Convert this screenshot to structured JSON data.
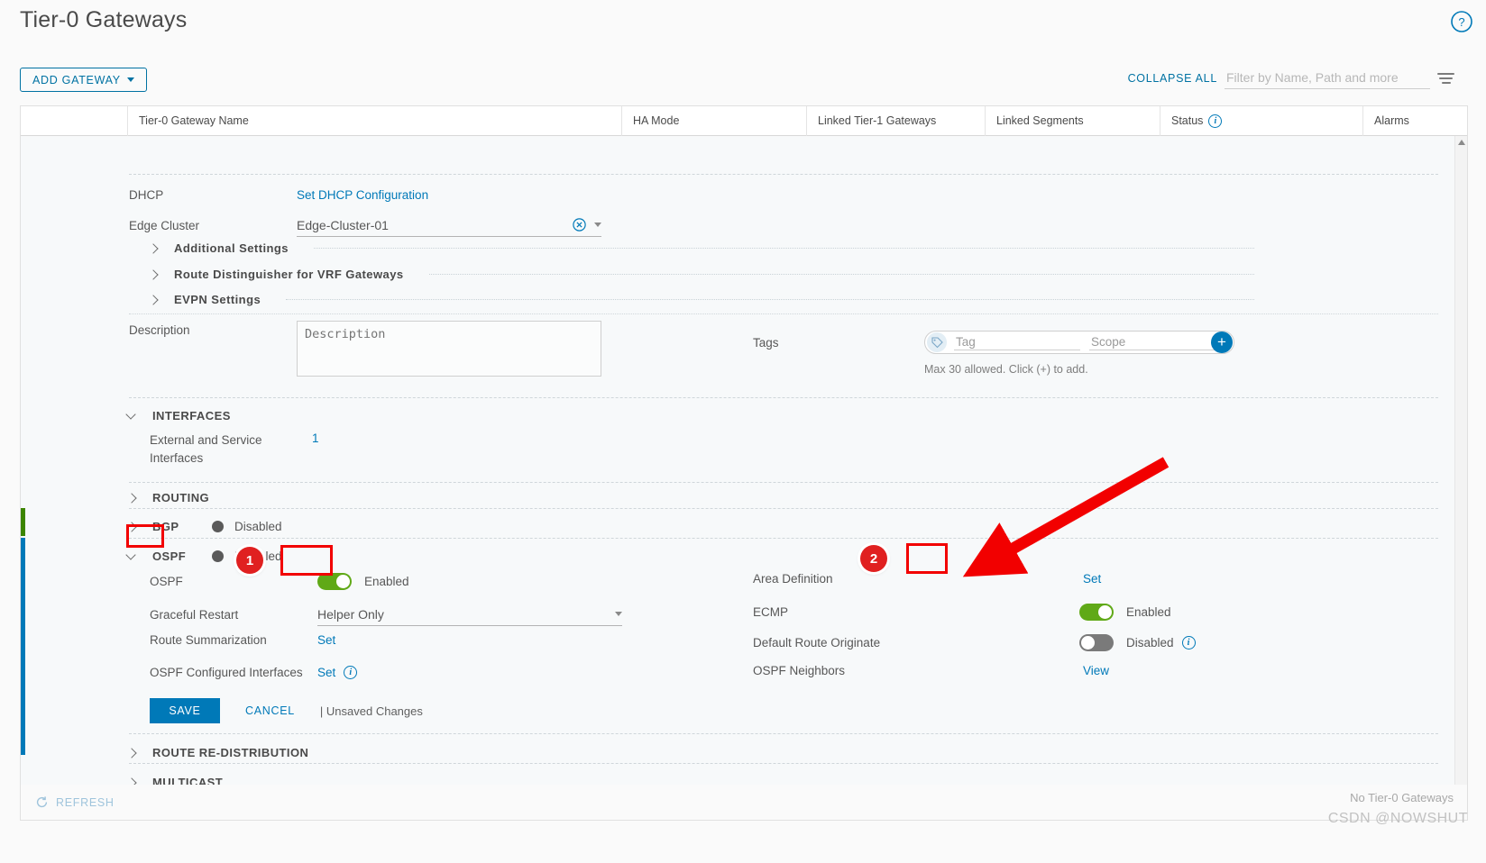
{
  "header": {
    "title": "Tier-0 Gateways",
    "help_icon": "help-circle-icon"
  },
  "toolbar": {
    "add_gateway_label": "ADD GATEWAY",
    "collapse_all_label": "COLLAPSE ALL",
    "filter_placeholder": "Filter by Name, Path and more",
    "filter_value": "",
    "filter_icon": "filter-icon"
  },
  "grid": {
    "columns": [
      "",
      "Tier-0 Gateway Name",
      "HA Mode",
      "Linked Tier-1 Gateways",
      "Linked Segments",
      "Status",
      "Alarms"
    ],
    "status_info_icon": "info-icon"
  },
  "detail": {
    "dhcp": {
      "label": "DHCP",
      "link": "Set DHCP Configuration"
    },
    "edge_cluster": {
      "label": "Edge Cluster",
      "value": "Edge-Cluster-01",
      "clear_icon": "clear-circle-icon",
      "caret_icon": "chevron-down-icon"
    },
    "collapsed_groups": [
      "Additional Settings",
      "Route Distinguisher for VRF Gateways",
      "EVPN Settings"
    ],
    "description": {
      "label": "Description",
      "placeholder": "Description",
      "value": ""
    },
    "tags": {
      "label": "Tags",
      "tag_placeholder": "Tag",
      "scope_placeholder": "Scope",
      "tag_value": "",
      "scope_value": "",
      "hint": "Max 30 allowed. Click (+) to add.",
      "tag_icon": "tag-icon",
      "add_icon": "plus-circle-icon"
    },
    "interfaces": {
      "title": "INTERFACES",
      "row_label": "External and Service Interfaces",
      "row_value": "1"
    },
    "routing": {
      "title": "ROUTING"
    },
    "bgp": {
      "title": "BGP",
      "status": "Disabled"
    },
    "ospf": {
      "title": "OSPF",
      "status": "Disabled",
      "left_rows": [
        {
          "label": "OSPF",
          "type": "toggle",
          "state": "on",
          "state_text": "Enabled"
        },
        {
          "label": "Graceful Restart",
          "type": "select",
          "value": "Helper Only"
        },
        {
          "label": "Route Summarization",
          "type": "link",
          "value": "Set"
        },
        {
          "label": "OSPF Configured Interfaces",
          "type": "link",
          "value": "Set",
          "info": true
        }
      ],
      "right_rows": [
        {
          "label": "Area Definition",
          "type": "link",
          "value": "Set"
        },
        {
          "label": "ECMP",
          "type": "toggle",
          "state": "on",
          "state_text": "Enabled"
        },
        {
          "label": "Default Route Originate",
          "type": "toggle",
          "state": "off",
          "state_text": "Disabled",
          "info": true
        },
        {
          "label": "OSPF Neighbors",
          "type": "link",
          "value": "View"
        }
      ],
      "save_label": "SAVE",
      "cancel_label": "CANCEL",
      "unsaved_label": "| Unsaved Changes"
    },
    "route_redistribution": {
      "title": "ROUTE RE-DISTRIBUTION"
    },
    "multicast": {
      "title": "MULTICAST"
    }
  },
  "footer": {
    "refresh_label": "REFRESH",
    "refresh_icon": "refresh-icon",
    "no_gateways": "No Tier-0 Gateways",
    "watermark": "CSDN @NOWSHUT"
  },
  "annotations": {
    "step1": "1",
    "step2": "2"
  },
  "colors": {
    "accent_blue": "#0079b8",
    "toggle_on": "#60a917",
    "toggle_off": "#7a7a7a",
    "highlight_red": "#f20000",
    "bar_green": "#3c8500",
    "bar_blue": "#0079b8"
  }
}
